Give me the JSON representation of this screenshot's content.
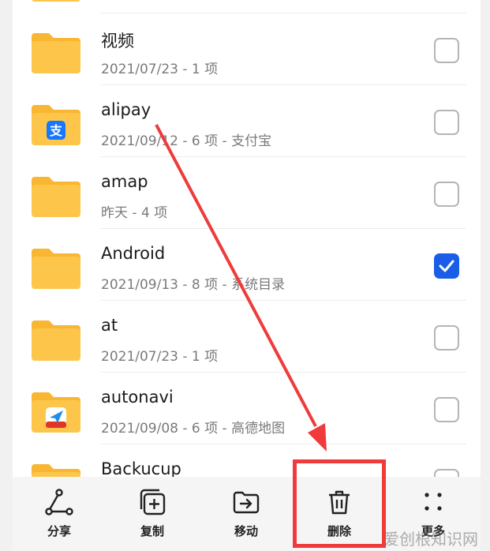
{
  "files": [
    {
      "name": "",
      "meta": "",
      "checked": false,
      "badge": "none"
    },
    {
      "name": "视频",
      "meta": "2021/07/23 - 1 项",
      "checked": false,
      "badge": "none"
    },
    {
      "name": "alipay",
      "meta": "2021/09/12 - 6 项 - 支付宝",
      "checked": false,
      "badge": "alipay-icon"
    },
    {
      "name": "amap",
      "meta": "昨天 - 4 项",
      "checked": false,
      "badge": "none"
    },
    {
      "name": "Android",
      "meta": "2021/09/13 - 8 项 - 系统目录",
      "checked": true,
      "badge": "none"
    },
    {
      "name": "at",
      "meta": "2021/07/23 - 1 项",
      "checked": false,
      "badge": "none"
    },
    {
      "name": "autonavi",
      "meta": "2021/09/08 - 6 项 - 高德地图",
      "checked": false,
      "badge": "gaode-map-icon"
    },
    {
      "name": "Backucup",
      "meta": "",
      "checked": false,
      "badge": "none"
    }
  ],
  "toolbar": {
    "share": "分享",
    "copy": "复制",
    "move": "移动",
    "delete": "删除",
    "more": "更多"
  },
  "watermark": "爱创根知识网",
  "colors": {
    "folder": "#fdc64a",
    "folder_tab": "#f8b632",
    "checkbox_checked": "#1a5ee8",
    "annotation": "#ef3b3b"
  }
}
